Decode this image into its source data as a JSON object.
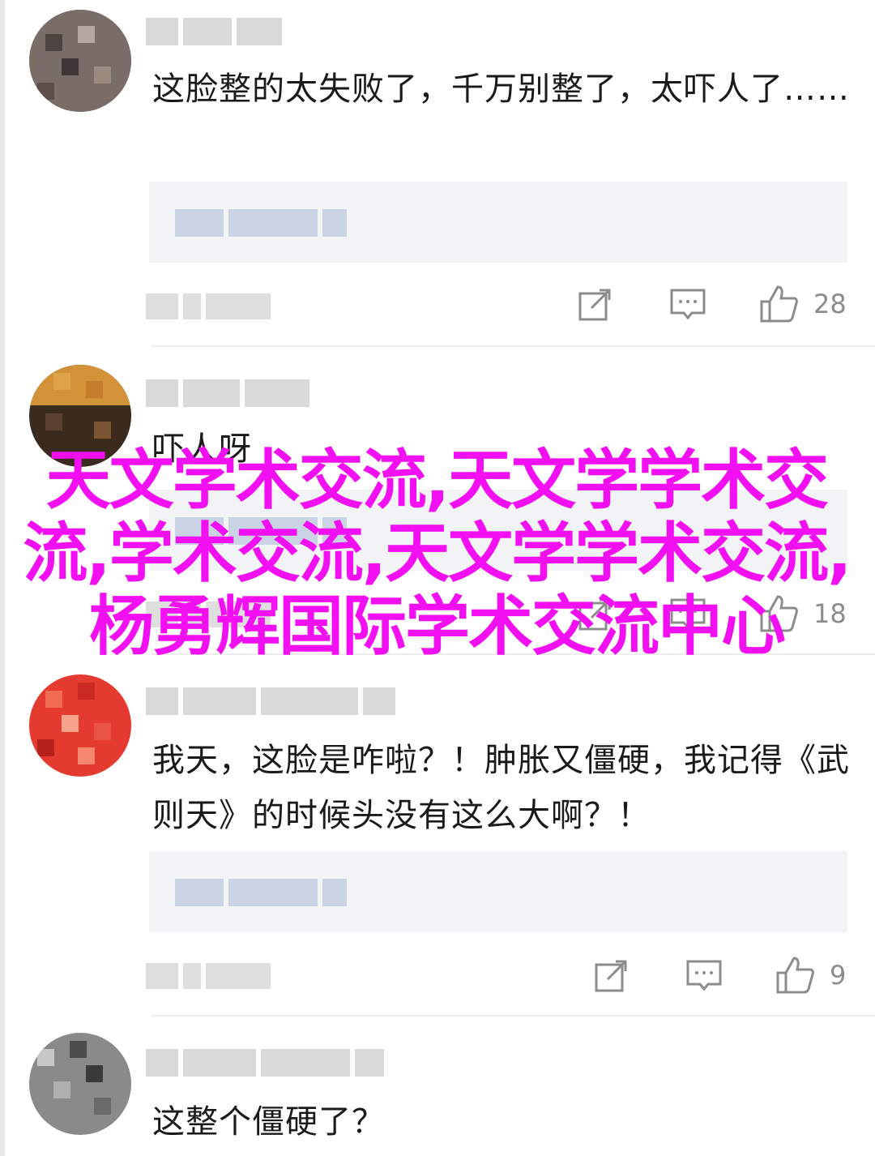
{
  "comments": [
    {
      "text": "这脸整的太失败了，千万别整了，太吓人了……",
      "likes": "28",
      "avatar_colors": [
        "#6b5d56",
        "#8d7f78",
        "#4d4340",
        "#b3a7a0",
        "#3e3534",
        "#9a8a80"
      ]
    },
    {
      "text": "吓人呀",
      "likes": "18",
      "avatar_colors": [
        "#c47d2a",
        "#3b2a1e",
        "#e0a448",
        "#5a4030",
        "#7a5532",
        "#2a1e18"
      ]
    },
    {
      "text": "我天，这脸是咋啦？！肿胀又僵硬，我记得《武则天》的时候头没有这么大啊？！",
      "likes": "9",
      "avatar_colors": [
        "#e43a2f",
        "#f06b4f",
        "#c92a22",
        "#f8a38b",
        "#e85545",
        "#b52018"
      ]
    },
    {
      "text": "这整个僵硬了？",
      "likes": "",
      "avatar_colors": [
        "#4d4d4d",
        "#8a8a8a",
        "#3a3a3a",
        "#b0b0b0",
        "#6b6b6b",
        "#c8c8c8"
      ]
    }
  ],
  "icons": {
    "share": "share-icon",
    "reply": "comment-icon",
    "like": "thumbs-up-icon"
  },
  "watermark": {
    "text": "天文学术交流,天文学学术交流,学术交流,天文学学术交流,杨勇辉国际学术交流中心",
    "color": "#f20ff2"
  }
}
